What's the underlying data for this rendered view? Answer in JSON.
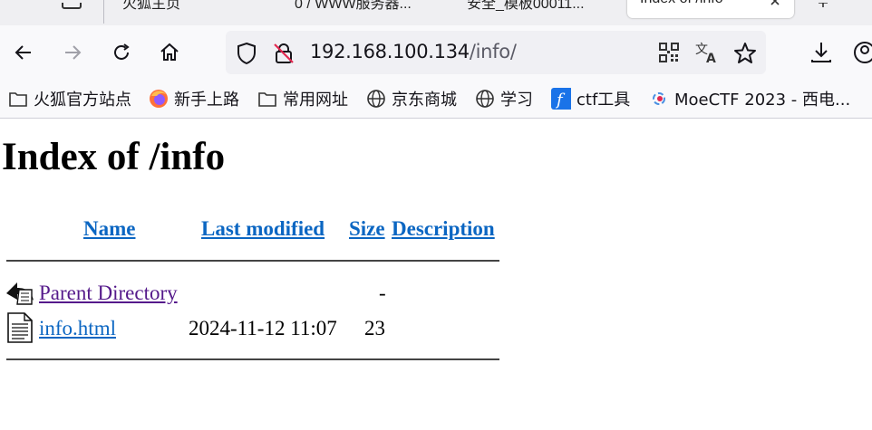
{
  "tabs": [
    {
      "label": "火狐主页",
      "active": false
    },
    {
      "label": "0 / WWW服务器...",
      "active": false
    },
    {
      "label": "安全_模板00011...",
      "active": false
    },
    {
      "label": "Index of /info",
      "active": true
    }
  ],
  "urlbar": {
    "host": "192.168.100.134",
    "path": "/info/"
  },
  "bookmarks": [
    {
      "label": "火狐官方站点",
      "icon": "folder-icon"
    },
    {
      "label": "新手上路",
      "icon": "firefox-icon"
    },
    {
      "label": "常用网址",
      "icon": "folder-icon"
    },
    {
      "label": "京东商城",
      "icon": "globe-icon"
    },
    {
      "label": "学习",
      "icon": "globe-icon"
    },
    {
      "label": "ctf工具",
      "icon": "ctf-icon"
    },
    {
      "label": "MoeCTF 2023 - 西电...",
      "icon": "moectf-icon"
    }
  ],
  "page": {
    "title": "Index of /info",
    "columns": {
      "name": "Name",
      "modified": "Last modified",
      "size": "Size",
      "description": "Description"
    },
    "rows": [
      {
        "name": "Parent Directory",
        "modified": "",
        "size": "-",
        "description": "",
        "icon": "back-icon"
      },
      {
        "name": "info.html",
        "modified": "2024-11-12 11:07",
        "size": "23",
        "description": "",
        "icon": "file-icon"
      }
    ]
  },
  "colors": {
    "link": "#0b66c2",
    "visited": "#551a8b"
  }
}
